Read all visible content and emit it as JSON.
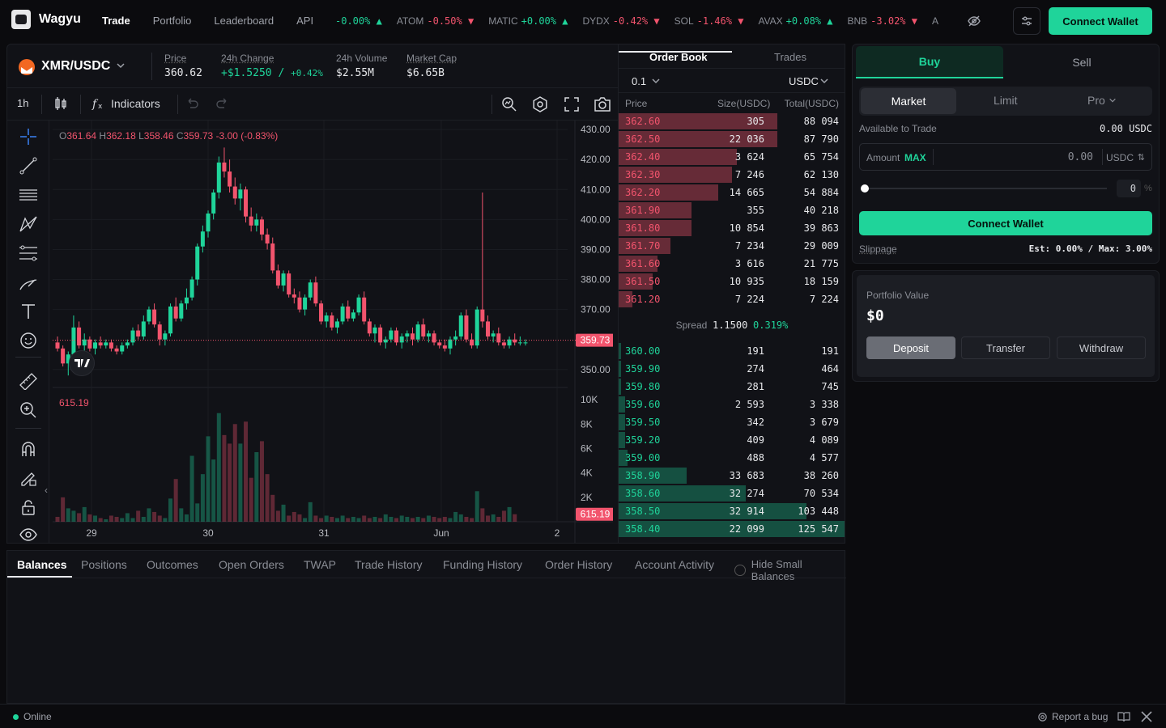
{
  "app": {
    "brand": "Wagyu"
  },
  "nav": {
    "items": [
      "Trade",
      "Portfolio",
      "Leaderboard",
      "API"
    ],
    "active": "Trade"
  },
  "ticker": [
    {
      "sym": "",
      "chg": "-0.00%",
      "dir": "up"
    },
    {
      "sym": "ATOM",
      "chg": "-0.50%",
      "dir": "down"
    },
    {
      "sym": "MATIC",
      "chg": "+0.00%",
      "dir": "up"
    },
    {
      "sym": "DYDX",
      "chg": "-0.42%",
      "dir": "down"
    },
    {
      "sym": "SOL",
      "chg": "-1.46%",
      "dir": "down"
    },
    {
      "sym": "AVAX",
      "chg": "+0.08%",
      "dir": "up"
    },
    {
      "sym": "BNB",
      "chg": "-3.02%",
      "dir": "down"
    },
    {
      "sym": "A",
      "chg": "",
      "dir": ""
    }
  ],
  "header": {
    "connect_wallet": "Connect Wallet"
  },
  "pair": {
    "name": "XMR/USDC",
    "price_label": "Price",
    "price": "360.62",
    "change_label": "24h Change",
    "change_abs": "+$1.5250",
    "change_sep": "/",
    "change_pct": "+0.42%",
    "volume_label": "24h Volume",
    "volume": "$2.55M",
    "mcap_label": "Market Cap",
    "mcap": "$6.65B"
  },
  "toolbar": {
    "interval": "1h",
    "indicators": "Indicators"
  },
  "ohlc": {
    "o": "361.64",
    "h": "362.18",
    "l": "358.46",
    "c": "359.73",
    "chg": "-3.00 (-0.83%)",
    "o_l": "O",
    "h_l": "H",
    "l_l": "L",
    "c_l": "C"
  },
  "chart_data": {
    "type": "candlestick",
    "price_ticks": [
      "430.00",
      "420.00",
      "410.00",
      "400.00",
      "390.00",
      "380.00",
      "370.00",
      "350.00"
    ],
    "price_tick_values": [
      430,
      420,
      410,
      400,
      390,
      380,
      370,
      350
    ],
    "ylim": [
      344,
      433
    ],
    "last_price": "359.73",
    "last_price_value": 359.73,
    "volume_ticks": [
      "10K",
      "8K",
      "6K",
      "4K",
      "2K"
    ],
    "volume_tick_values": [
      10000,
      8000,
      6000,
      4000,
      2000
    ],
    "volume_ylim": [
      0,
      11000
    ],
    "volume_label": "615.19",
    "last_volume": "615.19",
    "x_ticks": [
      "29",
      "30",
      "31",
      "Jun",
      "2"
    ],
    "candles": [
      [
        359,
        361,
        356,
        357
      ],
      [
        357,
        358,
        351,
        352
      ],
      [
        352,
        356,
        348,
        355
      ],
      [
        355,
        368,
        353,
        364
      ],
      [
        364,
        366,
        357,
        358
      ],
      [
        358,
        362,
        356,
        360
      ],
      [
        360,
        361,
        356,
        357
      ],
      [
        357,
        360,
        355,
        359
      ],
      [
        359,
        361,
        357,
        358
      ],
      [
        358,
        360,
        357,
        359
      ],
      [
        359,
        360,
        356,
        357
      ],
      [
        357,
        358,
        355,
        356
      ],
      [
        356,
        359,
        355,
        358
      ],
      [
        358,
        360,
        357,
        359
      ],
      [
        359,
        364,
        358,
        363
      ],
      [
        363,
        365,
        360,
        361
      ],
      [
        361,
        368,
        360,
        366
      ],
      [
        366,
        371,
        365,
        370
      ],
      [
        370,
        372,
        364,
        365
      ],
      [
        365,
        366,
        358,
        360
      ],
      [
        360,
        363,
        358,
        362
      ],
      [
        362,
        372,
        361,
        371
      ],
      [
        371,
        374,
        366,
        367
      ],
      [
        367,
        373,
        366,
        372
      ],
      [
        372,
        377,
        370,
        374
      ],
      [
        374,
        381,
        373,
        380
      ],
      [
        380,
        392,
        378,
        391
      ],
      [
        391,
        398,
        389,
        396
      ],
      [
        396,
        403,
        394,
        402
      ],
      [
        402,
        410,
        400,
        409
      ],
      [
        409,
        421,
        407,
        419
      ],
      [
        419,
        424,
        414,
        416
      ],
      [
        416,
        420,
        409,
        411
      ],
      [
        411,
        414,
        405,
        407
      ],
      [
        407,
        412,
        403,
        410
      ],
      [
        410,
        411,
        399,
        401
      ],
      [
        401,
        404,
        396,
        398
      ],
      [
        398,
        402,
        396,
        400
      ],
      [
        400,
        401,
        393,
        395
      ],
      [
        395,
        397,
        390,
        392
      ],
      [
        392,
        394,
        382,
        383
      ],
      [
        383,
        385,
        377,
        378
      ],
      [
        378,
        383,
        376,
        382
      ],
      [
        382,
        383,
        374,
        375
      ],
      [
        375,
        377,
        372,
        374
      ],
      [
        374,
        376,
        369,
        370
      ],
      [
        370,
        375,
        368,
        374
      ],
      [
        374,
        380,
        373,
        379
      ],
      [
        379,
        381,
        371,
        372
      ],
      [
        372,
        373,
        365,
        366
      ],
      [
        366,
        369,
        364,
        368
      ],
      [
        368,
        369,
        363,
        364
      ],
      [
        364,
        367,
        362,
        366
      ],
      [
        366,
        372,
        365,
        371
      ],
      [
        371,
        373,
        366,
        367
      ],
      [
        367,
        370,
        366,
        369
      ],
      [
        369,
        375,
        368,
        374
      ],
      [
        374,
        376,
        365,
        366
      ],
      [
        366,
        367,
        361,
        362
      ],
      [
        362,
        365,
        359,
        364
      ],
      [
        364,
        365,
        358,
        359
      ],
      [
        359,
        361,
        357,
        360
      ],
      [
        360,
        364,
        359,
        363
      ],
      [
        363,
        364,
        358,
        359
      ],
      [
        359,
        362,
        357,
        361
      ],
      [
        361,
        363,
        359,
        362
      ],
      [
        362,
        364,
        358,
        360
      ],
      [
        360,
        366,
        359,
        365
      ],
      [
        365,
        367,
        360,
        361
      ],
      [
        361,
        363,
        359,
        362
      ],
      [
        362,
        363,
        358,
        359
      ],
      [
        359,
        360,
        357,
        358
      ],
      [
        358,
        360,
        356,
        357
      ],
      [
        357,
        361,
        355,
        360
      ],
      [
        360,
        363,
        358,
        361
      ],
      [
        361,
        369,
        360,
        368
      ],
      [
        368,
        370,
        359,
        360
      ],
      [
        360,
        362,
        357,
        358
      ],
      [
        358,
        371,
        357,
        370
      ],
      [
        370,
        409,
        364,
        366
      ],
      [
        366,
        368,
        360,
        361
      ],
      [
        361,
        363,
        359,
        362
      ],
      [
        362,
        364,
        358,
        359
      ],
      [
        359,
        360,
        357,
        358
      ],
      [
        358,
        361,
        357,
        360
      ],
      [
        360,
        362,
        358,
        359
      ],
      [
        359,
        361,
        358,
        359
      ],
      [
        359,
        360,
        358,
        359
      ]
    ],
    "volumes": [
      400,
      2000,
      1100,
      900,
      700,
      1200,
      600,
      500,
      300,
      200,
      500,
      400,
      300,
      700,
      300,
      900,
      400,
      1100,
      800,
      500,
      300,
      1900,
      3500,
      1100,
      600,
      5400,
      1500,
      3900,
      7000,
      5100,
      8900,
      7100,
      6400,
      8000,
      6400,
      8200,
      3600,
      5700,
      6600,
      3900,
      2200,
      900,
      1400,
      500,
      800,
      600,
      300,
      1600,
      500,
      300,
      500,
      400,
      300,
      500,
      300,
      400,
      300,
      500,
      300,
      400,
      300,
      600,
      400,
      300,
      500,
      400,
      300,
      400,
      300,
      500,
      400,
      300,
      400,
      300,
      800,
      600,
      400,
      300,
      2500,
      1100,
      500,
      600,
      400,
      900,
      1200,
      615
    ]
  },
  "orderbook": {
    "tabs": [
      "Order Book",
      "Trades"
    ],
    "tick_size": "0.1",
    "quote": "USDC",
    "head": {
      "price": "Price",
      "size": "Size(USDC)",
      "total": "Total(USDC)"
    },
    "asks": [
      {
        "p": "362.60",
        "s": "305",
        "t": "88 094",
        "depth": 0.7
      },
      {
        "p": "362.50",
        "s": "22 036",
        "t": "87 790",
        "depth": 0.7
      },
      {
        "p": "362.40",
        "s": "3 624",
        "t": "65 754",
        "depth": 0.52
      },
      {
        "p": "362.30",
        "s": "7 246",
        "t": "62 130",
        "depth": 0.5
      },
      {
        "p": "362.20",
        "s": "14 665",
        "t": "54 884",
        "depth": 0.44
      },
      {
        "p": "361.90",
        "s": "355",
        "t": "40 218",
        "depth": 0.32
      },
      {
        "p": "361.80",
        "s": "10 854",
        "t": "39 863",
        "depth": 0.32
      },
      {
        "p": "361.70",
        "s": "7 234",
        "t": "29 009",
        "depth": 0.23
      },
      {
        "p": "361.60",
        "s": "3 616",
        "t": "21 775",
        "depth": 0.17
      },
      {
        "p": "361.50",
        "s": "10 935",
        "t": "18 159",
        "depth": 0.15
      },
      {
        "p": "361.20",
        "s": "7 224",
        "t": "7 224",
        "depth": 0.06
      }
    ],
    "spread_label": "Spread",
    "spread": "1.1500",
    "spread_pct": "0.319%",
    "bids": [
      {
        "p": "360.00",
        "s": "191",
        "t": "191",
        "depth": 0.01
      },
      {
        "p": "359.90",
        "s": "274",
        "t": "464",
        "depth": 0.01
      },
      {
        "p": "359.80",
        "s": "281",
        "t": "745",
        "depth": 0.01
      },
      {
        "p": "359.60",
        "s": "2 593",
        "t": "3 338",
        "depth": 0.03
      },
      {
        "p": "359.50",
        "s": "342",
        "t": "3 679",
        "depth": 0.03
      },
      {
        "p": "359.20",
        "s": "409",
        "t": "4 089",
        "depth": 0.03
      },
      {
        "p": "359.00",
        "s": "488",
        "t": "4 577",
        "depth": 0.04
      },
      {
        "p": "358.90",
        "s": "33 683",
        "t": "38 260",
        "depth": 0.3
      },
      {
        "p": "358.60",
        "s": "32 274",
        "t": "70 534",
        "depth": 0.56
      },
      {
        "p": "358.50",
        "s": "32 914",
        "t": "103 448",
        "depth": 0.83
      },
      {
        "p": "358.40",
        "s": "22 099",
        "t": "125 547",
        "depth": 1.0
      }
    ]
  },
  "trade": {
    "buy": "Buy",
    "sell": "Sell",
    "types": [
      "Market",
      "Limit",
      "Pro"
    ],
    "available_label": "Available to Trade",
    "available_value": "0.00 USDC",
    "amount_label": "Amount",
    "max": "MAX",
    "amount_value": "0.00",
    "amount_unit": "USDC",
    "pct_value": "0",
    "pct_unit": "%",
    "connect_wallet": "Connect Wallet",
    "slippage_label": "Slippage",
    "slippage_value": "Est: 0.00% / Max: 3.00%"
  },
  "portfolio": {
    "label": "Portfolio Value",
    "value": "$0",
    "deposit": "Deposit",
    "transfer": "Transfer",
    "withdraw": "Withdraw"
  },
  "bottom": {
    "tabs": [
      "Balances",
      "Positions",
      "Outcomes",
      "Open Orders",
      "TWAP",
      "Trade History",
      "Funding History",
      "Order History",
      "Account Activity"
    ],
    "hide_small": "Hide Small Balances"
  },
  "footer": {
    "status": "Online",
    "report": "Report a bug"
  },
  "colors": {
    "up": "#1fd49a",
    "down": "#f2546d",
    "accent": "#1fd49a"
  }
}
